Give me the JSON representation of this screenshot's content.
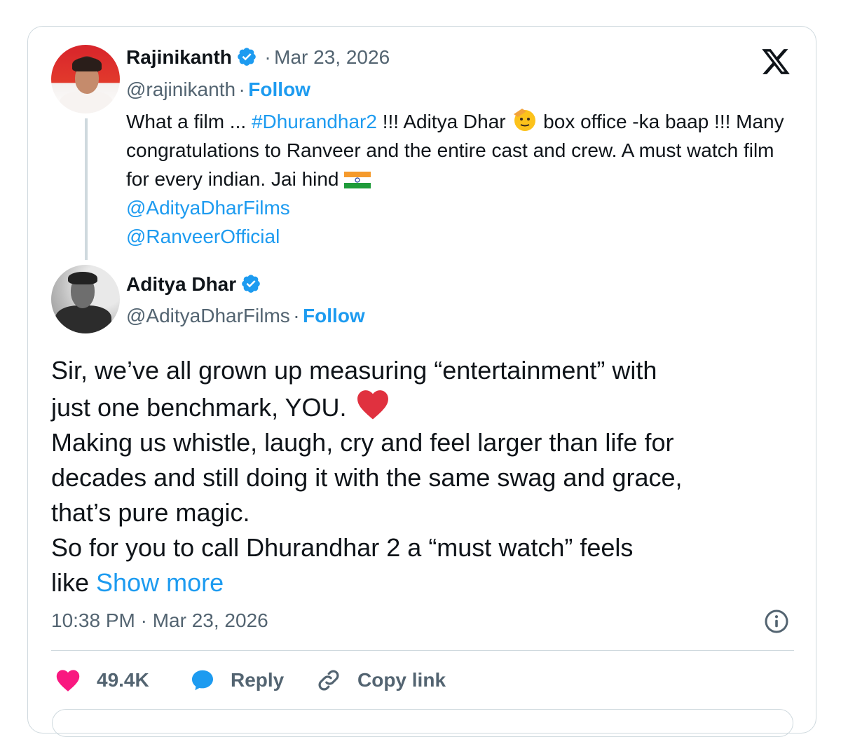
{
  "quoted_tweet": {
    "author_name": "Rajinikanth",
    "handle": "@rajinikanth",
    "separator": "·",
    "date": "Mar 23, 2026",
    "follow_label": "Follow",
    "text_part1": "What a film ... ",
    "hashtag": "#Dhurandhar2",
    "text_part2": " !!! Aditya Dhar ",
    "text_part3": " box office -ka baap !!! Many congratulations to Ranveer and the entire cast and crew. A must watch film for every indian. Jai hind ",
    "mention1": "@AdityaDharFilms",
    "mention2": "@RanveerOfficial"
  },
  "reply_tweet": {
    "author_name": "Aditya Dhar",
    "handle": "@AdityaDharFilms",
    "separator": "·",
    "follow_label": "Follow",
    "line1": "Sir, we’ve all grown up measuring “entertainment” with",
    "line2": "just one benchmark, YOU. ",
    "line3": "Making us whistle, laugh, cry and feel larger than life for",
    "line4": "decades and still doing it with the same swag and grace,",
    "line5": "that’s pure magic.",
    "line6": "So for you to call Dhurandhar 2 a “must watch” feels",
    "line7": "like ",
    "show_more": "Show more",
    "timestamp": "10:38 PM · Mar 23, 2026"
  },
  "actions": {
    "likes_count": "49.4K",
    "reply_label": "Reply",
    "copy_link_label": "Copy link"
  },
  "icons": {
    "brand": "x-logo-icon",
    "verified": "verified-badge-icon",
    "info": "info-icon",
    "like": "heart-icon",
    "reply": "speech-bubble-icon",
    "copy": "link-icon"
  },
  "colors": {
    "accent": "#1d9bf0",
    "like": "#f91880",
    "muted": "#536471",
    "text": "#0f1419",
    "border": "#cfd9de"
  }
}
